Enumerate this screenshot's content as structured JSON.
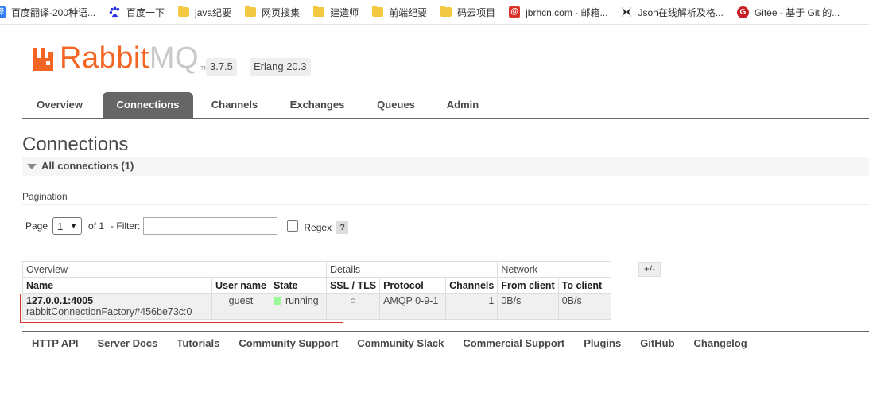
{
  "bookmarks": [
    {
      "label": "百度翻译-200种语...",
      "icon": "fanyi-icon"
    },
    {
      "label": "百度一下",
      "icon": "baidu-icon"
    },
    {
      "label": "java纪要",
      "icon": "folder-icon"
    },
    {
      "label": "网页搜集",
      "icon": "folder-icon"
    },
    {
      "label": "建造师",
      "icon": "folder-icon"
    },
    {
      "label": "前端纪要",
      "icon": "folder-icon"
    },
    {
      "label": "码云项目",
      "icon": "folder-icon"
    },
    {
      "label": "jbrhcn.com - 邮箱...",
      "icon": "mail-icon"
    },
    {
      "label": "Json在线解析及格...",
      "icon": "json-icon"
    },
    {
      "label": "Gitee - 基于 Git 的...",
      "icon": "gitee-icon"
    }
  ],
  "header": {
    "logo_rabbit": "Rabbit",
    "logo_mq": "MQ",
    "logo_tm": "TM",
    "version": "3.7.5",
    "erlang": "Erlang 20.3"
  },
  "tabs": [
    "Overview",
    "Connections",
    "Channels",
    "Exchanges",
    "Queues",
    "Admin"
  ],
  "active_tab": "Connections",
  "page": {
    "title": "Connections",
    "section": "All connections (1)",
    "pagination_label": "Pagination",
    "page_label": "Page",
    "page_value": "1",
    "of_label": "of 1",
    "filter_label": "- Filter:",
    "filter_value": "",
    "regex_label": "Regex",
    "help": "?"
  },
  "table": {
    "groups": [
      "Overview",
      "Details",
      "Network"
    ],
    "plus_minus": "+/-",
    "headers": [
      "Name",
      "User name",
      "State",
      "SSL / TLS",
      "Protocol",
      "Channels",
      "From client",
      "To client"
    ],
    "rows": [
      {
        "name": "127.0.0.1:4005",
        "sub": "rabbitConnectionFactory#456be73c:0",
        "user": "guest",
        "state": "running",
        "ssl": "○",
        "protocol": "AMQP 0-9-1",
        "channels": "1",
        "from_client": "0B/s",
        "to_client": "0B/s"
      }
    ]
  },
  "footer": [
    "HTTP API",
    "Server Docs",
    "Tutorials",
    "Community Support",
    "Community Slack",
    "Commercial Support",
    "Plugins",
    "GitHub",
    "Changelog"
  ],
  "colors": {
    "brand_orange": "#f26522",
    "tab_active": "#666666",
    "running": "#98f898",
    "highlight": "#d9302a"
  }
}
